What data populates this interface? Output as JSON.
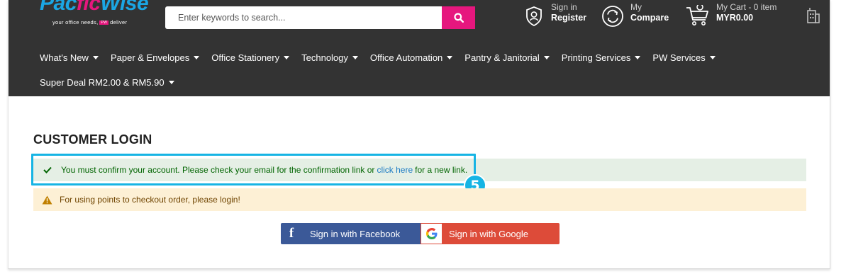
{
  "header": {
    "logo": {
      "part1": "Pac",
      "part2": "fic",
      "part3": "Wise",
      "tagline_a": "your office needs,",
      "tagline_badge": "PW",
      "tagline_b": "deliver"
    },
    "search": {
      "placeholder": "Enter keywords to search...",
      "icon": "search-icon"
    },
    "signin": {
      "line1": "Sign in",
      "line2": "Register",
      "icon": "user-shield-icon"
    },
    "compare": {
      "line1": "My",
      "line2": "Compare",
      "icon": "compare-arrows-icon"
    },
    "cart": {
      "line1": "My Cart - 0 item",
      "line2": "MYR0.00",
      "icon": "cart-icon"
    },
    "account_icon": "building-icon"
  },
  "nav": {
    "items": [
      {
        "label": "What's New"
      },
      {
        "label": "Paper & Envelopes"
      },
      {
        "label": "Office Stationery"
      },
      {
        "label": "Technology"
      },
      {
        "label": "Office Automation"
      },
      {
        "label": "Pantry & Janitorial"
      },
      {
        "label": "Printing Services"
      },
      {
        "label": "PW Services"
      }
    ],
    "row2": {
      "label": "Super Deal RM2.00 & RM5.90"
    }
  },
  "main": {
    "title": "CUSTOMER LOGIN",
    "success": {
      "pre": "You must confirm your account. Please check your email for the confirmation link or",
      "link": "click here",
      "post": "for a new link."
    },
    "warning": {
      "text": "For using points to checkout order, please login!"
    },
    "step_badge": "5",
    "facebook": {
      "icon": "f",
      "label": "Sign in with Facebook"
    },
    "google": {
      "label": "Sign in with Google"
    }
  },
  "colors": {
    "header_bg": "#333333",
    "brand_blue": "#1ba6e3",
    "brand_pink": "#e6177e",
    "highlight": "#16b4e4",
    "facebook": "#3b5998",
    "google": "#dd4b39"
  }
}
